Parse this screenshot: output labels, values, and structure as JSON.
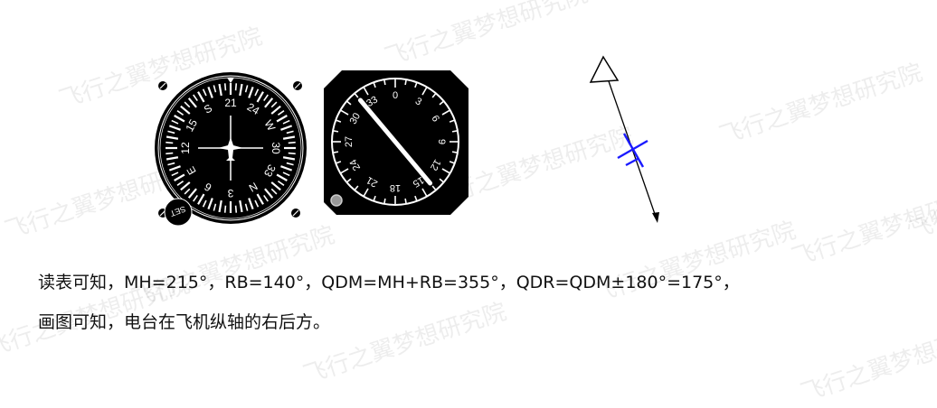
{
  "watermark": "飞行之翼梦想研究院",
  "compass": {
    "labels": [
      "21",
      "24",
      "W",
      "30",
      "33",
      "N",
      "3",
      "6",
      "E",
      "12",
      "15",
      "S"
    ],
    "knob_label": "SET"
  },
  "rmi": {
    "labels": [
      "0",
      "3",
      "6",
      "9",
      "12",
      "15",
      "18",
      "21",
      "24",
      "27",
      "30",
      "33"
    ],
    "needle_bearing_deg": 140
  },
  "colors": {
    "aircraft_symbol": "#1a1aff"
  },
  "text": {
    "line1": "读表可知，MH=215°，RB=140°，QDM=MH+RB=355°，QDR=QDM±180°=175°，",
    "line2": "画图可知，电台在飞机纵轴的右后方。"
  }
}
